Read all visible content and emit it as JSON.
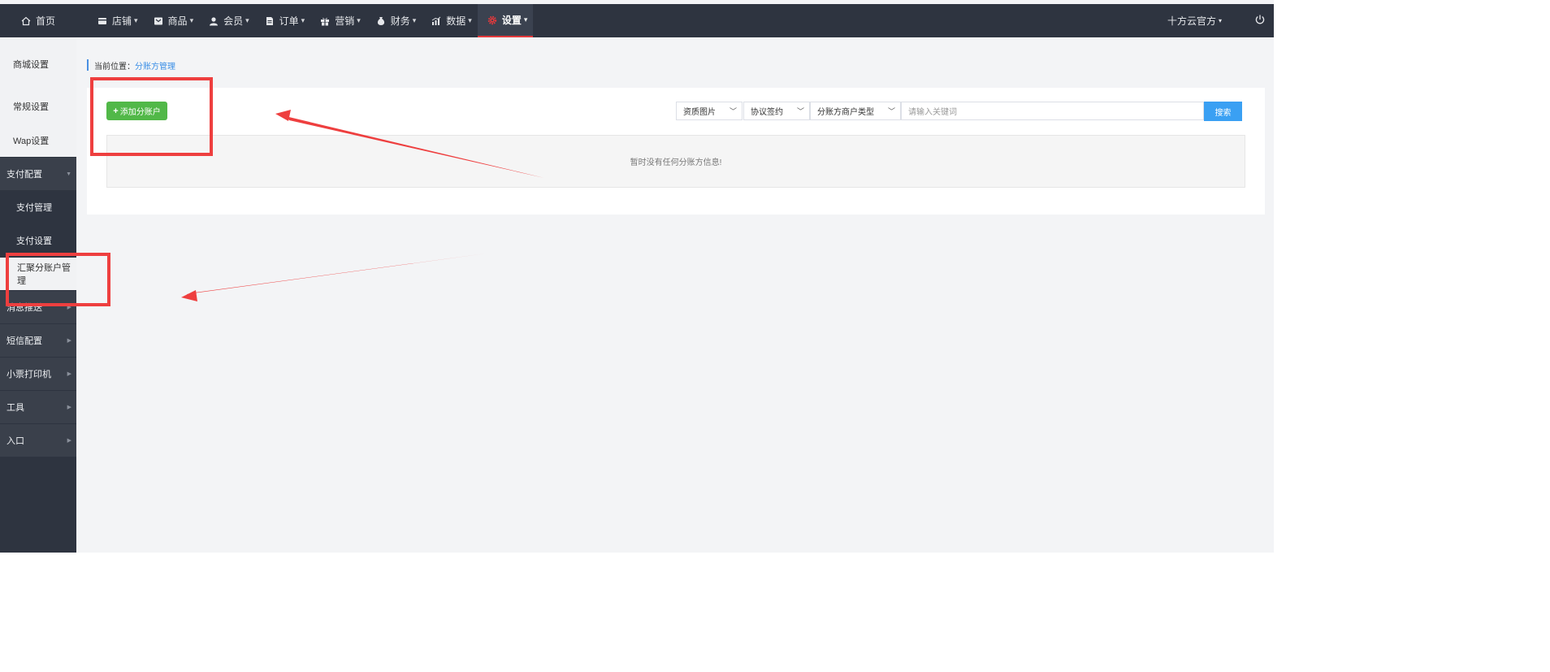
{
  "topbar": {
    "home_label": "首页",
    "nav": [
      {
        "label": "店铺",
        "icon": "store-icon",
        "active": false
      },
      {
        "label": "商品",
        "icon": "goods-icon",
        "active": false
      },
      {
        "label": "会员",
        "icon": "member-icon",
        "active": false
      },
      {
        "label": "订单",
        "icon": "order-icon",
        "active": false
      },
      {
        "label": "营销",
        "icon": "gift-icon",
        "active": false
      },
      {
        "label": "财务",
        "icon": "money-bag-icon",
        "active": false
      },
      {
        "label": "数据",
        "icon": "chart-icon",
        "active": false
      },
      {
        "label": "设置",
        "icon": "gear-icon",
        "active": true
      }
    ],
    "user_label": "十方云官方",
    "accent_color": "#e4393c"
  },
  "sidebar": {
    "items": [
      {
        "label": "商城设置"
      },
      {
        "label": "常规设置"
      },
      {
        "label": "Wap设置"
      },
      {
        "label": "支付配置",
        "expanded": true
      },
      {
        "label": "支付管理"
      },
      {
        "label": "支付设置"
      },
      {
        "label": "汇聚分账户管理",
        "current": true
      },
      {
        "label": "消息推送"
      },
      {
        "label": "短信配置"
      },
      {
        "label": "小票打印机"
      },
      {
        "label": "工具"
      },
      {
        "label": "入口"
      }
    ]
  },
  "breadcrumb": {
    "prefix": "当前位置：",
    "current": "分账方管理"
  },
  "toolbar": {
    "add_label": "添加分账户",
    "filters": [
      "资质图片",
      "协议签约",
      "分账方商户类型"
    ],
    "search_placeholder": "请输入关键词",
    "search_label": "搜索"
  },
  "table": {
    "empty_text": "暂时没有任何分账方信息!"
  }
}
